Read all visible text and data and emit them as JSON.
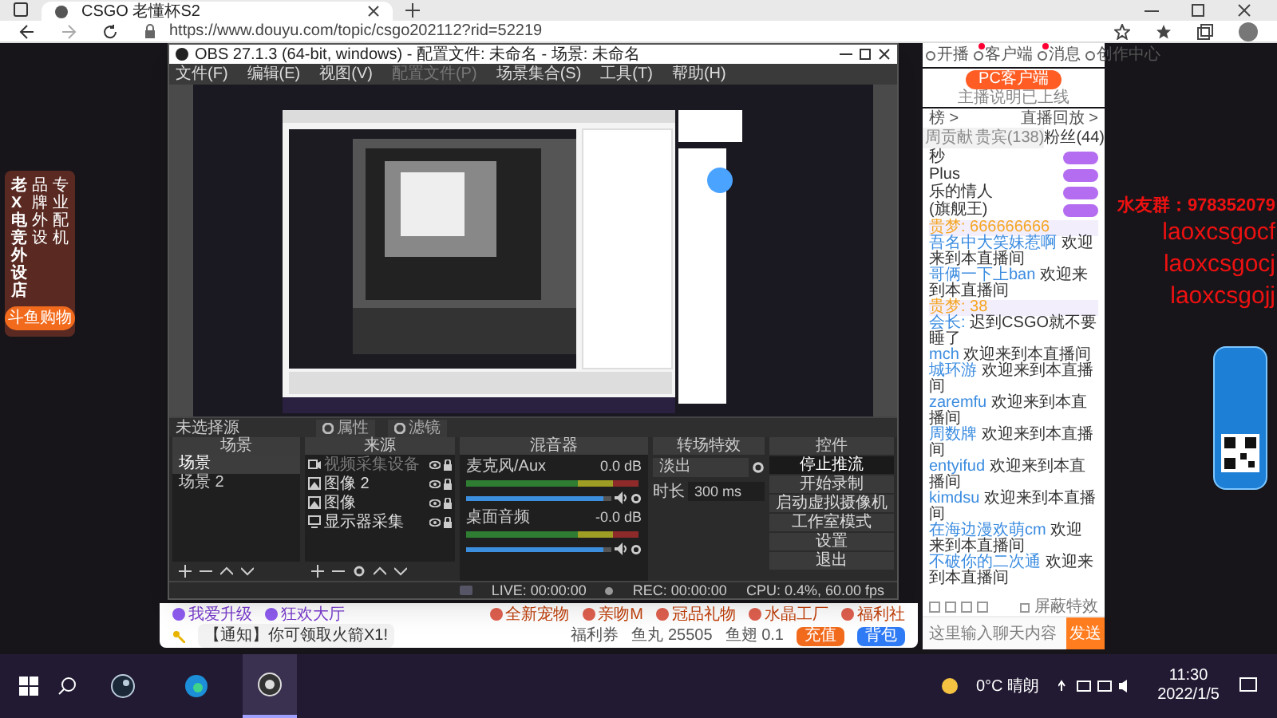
{
  "browser": {
    "tab_title": "CSGO 老懂杯S2",
    "url": "https://www.douyu.com/topic/csgo202112?rid=52219"
  },
  "site_header": {
    "items": [
      {
        "label": "开播",
        "badge": false
      },
      {
        "label": "客户端",
        "badge": true
      },
      {
        "label": "消息",
        "badge": true
      },
      {
        "label": "创作中心",
        "badge": false
      }
    ]
  },
  "left_banner": {
    "column_1": "老X电竞外设店",
    "column_2": "品牌外设",
    "column_3": "专业配机",
    "button": "斗鱼购物"
  },
  "obs": {
    "title": "OBS 27.1.3 (64-bit, windows) - 配置文件: 未命名 - 场景: 未命名",
    "menu": [
      {
        "label": "文件(F)",
        "disabled": false
      },
      {
        "label": "编辑(E)",
        "disabled": false
      },
      {
        "label": "视图(V)",
        "disabled": false
      },
      {
        "label": "配置文件(P)",
        "disabled": true
      },
      {
        "label": "场景集合(S)",
        "disabled": false
      },
      {
        "label": "工具(T)",
        "disabled": false
      },
      {
        "label": "帮助(H)",
        "disabled": false
      }
    ],
    "source_bar": {
      "label": "未选择源",
      "buttons": [
        "属性",
        "滤镜"
      ]
    },
    "scenes": {
      "title": "场景",
      "items": [
        {
          "label": "场景",
          "selected": true
        },
        {
          "label": "场景 2",
          "selected": false
        }
      ]
    },
    "sources": {
      "title": "来源",
      "items": [
        {
          "label": "视频采集设备",
          "kind": "camera",
          "disabled": true
        },
        {
          "label": "图像 2",
          "kind": "image",
          "disabled": false
        },
        {
          "label": "图像",
          "kind": "image",
          "disabled": false
        },
        {
          "label": "显示器采集",
          "kind": "display",
          "disabled": false
        }
      ]
    },
    "mixer": {
      "title": "混音器",
      "channels": [
        {
          "name": "麦克风/Aux",
          "reading": "0.0 dB",
          "level": 0.95
        },
        {
          "name": "桌面音频",
          "reading": "-0.0 dB",
          "level": 0.95
        }
      ]
    },
    "transitions": {
      "title": "转场特效",
      "transition": "淡出",
      "duration_label": "时长",
      "duration": "300 ms"
    },
    "controls": {
      "title": "控件",
      "buttons": [
        {
          "label": "停止推流",
          "selected": true
        },
        {
          "label": "开始录制",
          "selected": false
        },
        {
          "label": "启动虚拟摄像机",
          "selected": false
        },
        {
          "label": "工作室模式",
          "selected": false
        },
        {
          "label": "设置",
          "selected": false
        },
        {
          "label": "退出",
          "selected": false
        }
      ]
    },
    "status": {
      "live": "LIVE: 00:00:00",
      "rec": "REC: 00:00:00",
      "cpu": "CPU: 0.4%, 60.00 fps"
    }
  },
  "side_panel": {
    "client_button": "PC客户端",
    "client_note": "主播说明已上线",
    "links": [
      "榜 >",
      "直播回放 >"
    ],
    "tabs": [
      {
        "label": "周贡献",
        "selected": false
      },
      {
        "label": "贵宾(138)",
        "selected": false
      },
      {
        "label": "粉丝(44)",
        "selected": true
      }
    ],
    "ranks": [
      "秒",
      "Plus",
      "乐的情人",
      "(旗舰王)"
    ],
    "messages": [
      {
        "kind": "noble",
        "user": "贵梦:",
        "text": "666666666"
      },
      {
        "kind": "welcome",
        "user": "吾名中大笑妹惹啊",
        "text": "欢迎来到本直播间"
      },
      {
        "kind": "welcome",
        "user": "哥俩一下上ban",
        "text": "欢迎来到本直播间"
      },
      {
        "kind": "noble",
        "user": "贵梦:",
        "text": "38"
      },
      {
        "kind": "chat",
        "user": "会长:",
        "text": "迟到CSGO就不要睡了"
      },
      {
        "kind": "welcome",
        "user": "mch",
        "text": "欢迎来到本直播间"
      },
      {
        "kind": "welcome",
        "user": "城环游",
        "text": "欢迎来到本直播间"
      },
      {
        "kind": "welcome",
        "user": "zaremfu",
        "text": "欢迎来到本直播间"
      },
      {
        "kind": "welcome",
        "user": "周数牌",
        "text": "欢迎来到本直播间"
      },
      {
        "kind": "welcome",
        "user": "entyifud",
        "text": "欢迎来到本直播间"
      },
      {
        "kind": "welcome",
        "user": "kimdsu",
        "text": "欢迎来到本直播间"
      },
      {
        "kind": "welcome",
        "user": "在海边漫欢萌cm",
        "text": "欢迎来到本直播间"
      },
      {
        "kind": "welcome",
        "user": "不破你的二次通",
        "text": "欢迎来到本直播间"
      }
    ],
    "block_effects": "屏蔽特效",
    "input_placeholder": "这里输入聊天内容",
    "send": "发送"
  },
  "overlay": {
    "group": "水友群：978352079",
    "ids": [
      "laoxcsgocf",
      "laoxcsgocj",
      "laoxcsgojj"
    ]
  },
  "bottom_bar": {
    "activities": [
      "我爱升级",
      "狂欢大厅"
    ],
    "gifts": [
      "全新宠物",
      "亲吻M",
      "冠品礼物",
      "水晶工厂",
      "福利社"
    ],
    "notice": "【通知】你可领取火箭X1!",
    "coupon": "福利券",
    "fish_balls": "鱼丸 25505",
    "fish_fins": "鱼翅 0.1",
    "recharge": "充值",
    "backpack": "背包"
  },
  "taskbar": {
    "apps": [
      {
        "kind": "steam",
        "active": false
      },
      {
        "kind": "edge",
        "active": false
      },
      {
        "kind": "obs",
        "active": true
      }
    ],
    "weather": "0°C 晴朗",
    "time": "11:30",
    "date": "2022/1/5"
  }
}
